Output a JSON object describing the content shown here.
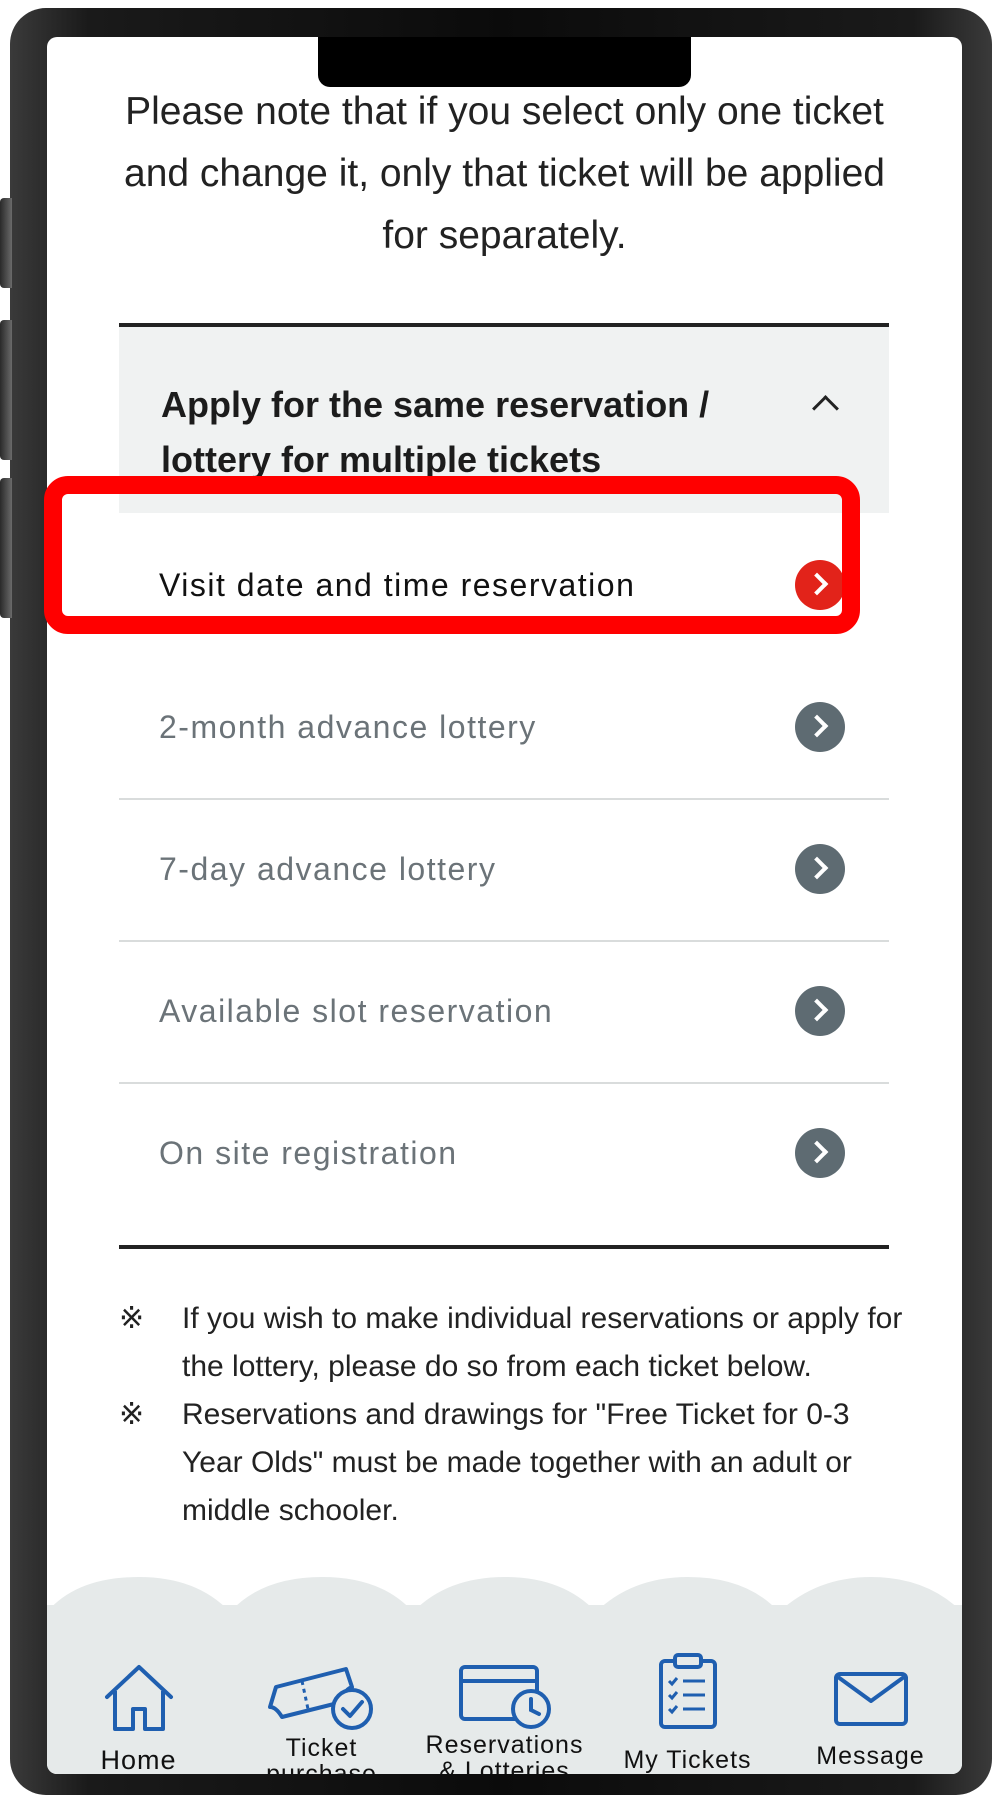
{
  "note_top": "Please note that if you select only one ticket and change it, only that ticket will be applied for separately.",
  "accordion": {
    "title": "Apply for the same reservation / lottery for multiple tickets",
    "rows": [
      {
        "label": "Visit date and time reservation",
        "active": true
      },
      {
        "label": "2-month advance lottery",
        "active": false
      },
      {
        "label": "7-day advance lottery",
        "active": false
      },
      {
        "label": "Available slot reservation",
        "active": false
      },
      {
        "label": "On site registration",
        "active": false
      }
    ]
  },
  "notes": {
    "mark": "※",
    "items": [
      "If you wish to make individual reservations or apply for the lottery, please do so from each ticket below.",
      "Reservations and drawings for \"Free Ticket for 0-3 Year Olds\" must be made together with an adult or middle schooler."
    ]
  },
  "bottom_nav": {
    "home": "Home",
    "ticket_purchase_line1": "Ticket",
    "ticket_purchase_line2": "purchase",
    "reservations_line1": "Reservations",
    "reservations_line2": "& Lotteries",
    "my_tickets": "My Tickets",
    "message": "Message"
  },
  "colors": {
    "accent_red": "#e2231a",
    "highlight_red": "#ff0000",
    "chevron_gray": "#5e6b72",
    "icon_blue": "#1f5fb0",
    "nav_background": "#e6eaea"
  }
}
